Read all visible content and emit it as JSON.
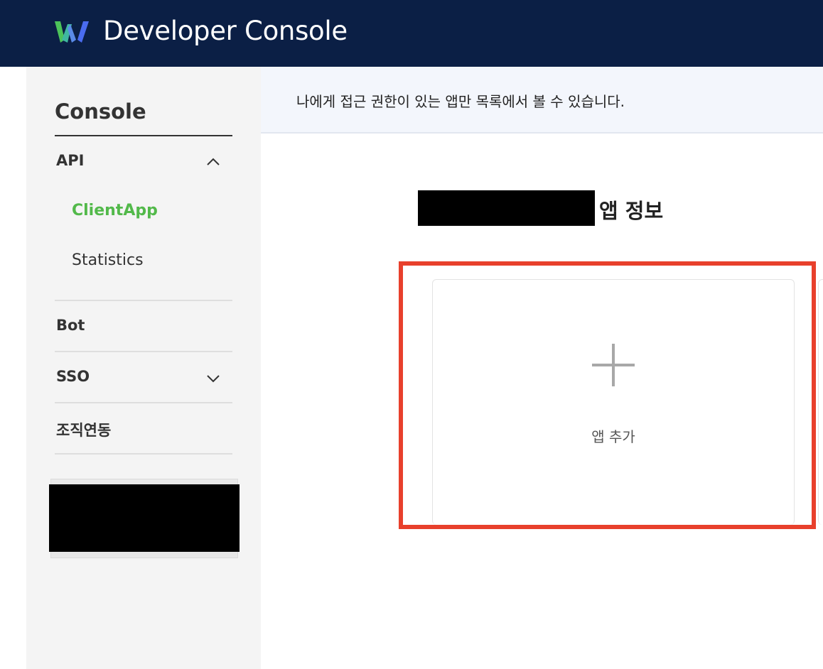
{
  "header": {
    "title": "Developer Console",
    "logo_icon": "works-logo-icon",
    "colors": {
      "background": "#0b1f45",
      "logo_green": "#4cc35a",
      "logo_blue": "#4a6cf0"
    }
  },
  "sidebar": {
    "title": "Console",
    "sections": [
      {
        "label": "API",
        "expanded": true,
        "chevron": "chevron-up-icon",
        "items": [
          {
            "label": "ClientApp",
            "active": true
          },
          {
            "label": "Statistics",
            "active": false
          }
        ]
      },
      {
        "label": "Bot"
      },
      {
        "label": "SSO",
        "expanded": false,
        "chevron": "chevron-down-icon"
      },
      {
        "label": "조직연동"
      }
    ],
    "active_color": "#52b94a"
  },
  "main": {
    "notice": "나에게 접근 권한이 있는 앱만 목록에서 볼 수 있습니다.",
    "section_title_suffix": "앱 정보",
    "add_card": {
      "label": "앱 추가",
      "icon": "plus-icon"
    },
    "highlight_color": "#e8402c"
  }
}
